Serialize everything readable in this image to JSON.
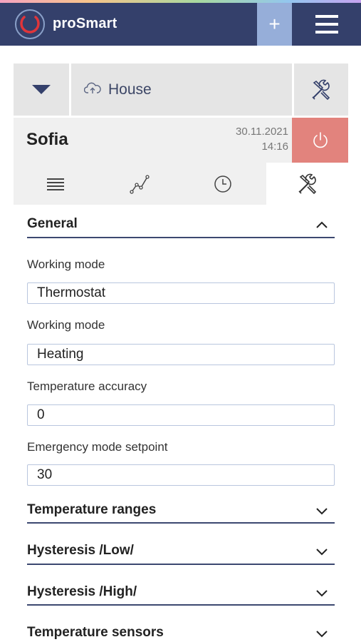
{
  "app": {
    "brand": "proSmart"
  },
  "header": {
    "plus_label": "+"
  },
  "selector": {
    "location": "House"
  },
  "device": {
    "name": "Sofia",
    "date": "30.11.2021",
    "time": "14:16"
  },
  "colors": {
    "navy": "#34406b",
    "accent": "#96aed9",
    "power": "#e2837d",
    "logo_red": "#e0353a"
  },
  "tabs": [
    {
      "icon": "list-icon",
      "active": false
    },
    {
      "icon": "chart-line-icon",
      "active": false
    },
    {
      "icon": "clock-icon",
      "active": false
    },
    {
      "icon": "tools-icon",
      "active": true
    }
  ],
  "general": {
    "title": "General",
    "fields": [
      {
        "label": "Working mode",
        "value": "Thermostat"
      },
      {
        "label": "Working mode",
        "value": "Heating"
      },
      {
        "label": "Temperature accuracy",
        "value": "0"
      },
      {
        "label": "Emergency mode setpoint",
        "value": "30"
      }
    ]
  },
  "sections": [
    {
      "title": "Temperature ranges"
    },
    {
      "title": "Hysteresis /Low/"
    },
    {
      "title": "Hysteresis /High/"
    },
    {
      "title": "Temperature sensors"
    }
  ]
}
